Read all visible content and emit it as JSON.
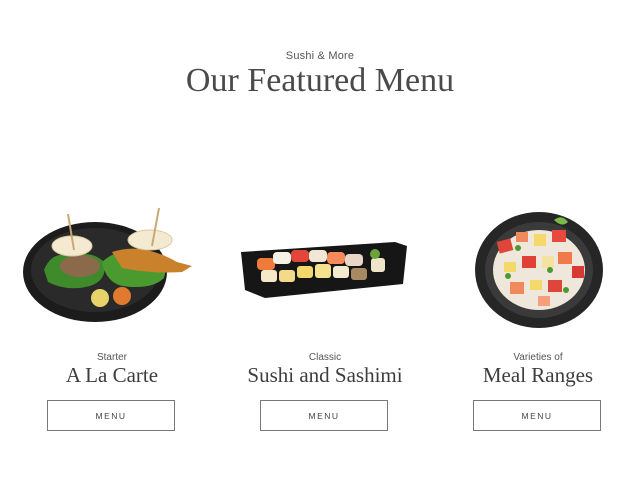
{
  "header": {
    "kicker": "Sushi & More",
    "title": "Our Featured Menu"
  },
  "items": [
    {
      "subtitle": "Starter",
      "name": "A La Carte",
      "button": "MENU",
      "image": "burger-skewer-plate"
    },
    {
      "subtitle": "Classic",
      "name": "Sushi and Sashimi",
      "button": "MENU",
      "image": "sushi-platter"
    },
    {
      "subtitle": "Varieties of",
      "name": "Meal Ranges",
      "button": "MENU",
      "image": "chirashi-bowl"
    }
  ],
  "colors": {
    "text": "#4a4a4a",
    "plate": "#1e1e1e",
    "button_border": "#777777"
  }
}
